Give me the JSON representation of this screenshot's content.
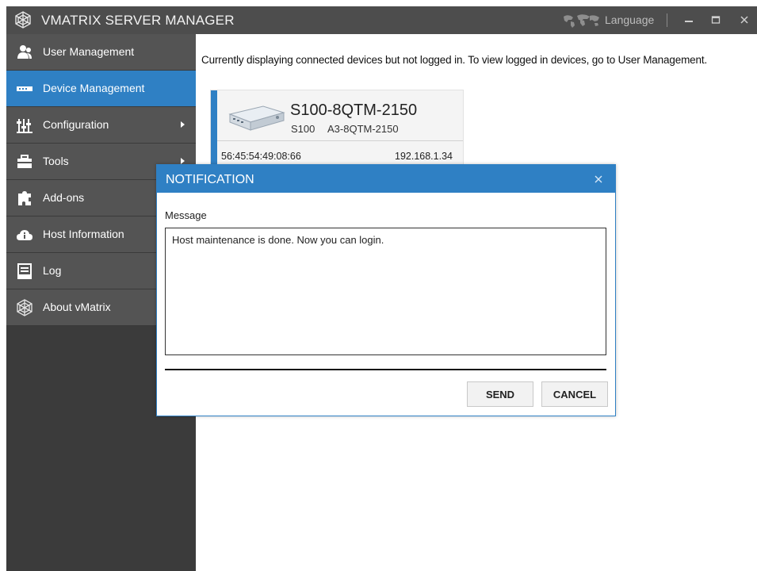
{
  "titlebar": {
    "title": "VMATRIX SERVER MANAGER",
    "language_label": "Language",
    "icons": [
      "app-logo-icon",
      "world-map-icon",
      "minimize-icon",
      "maximize-icon",
      "close-icon"
    ]
  },
  "sidebar": {
    "items": [
      {
        "label": "User Management",
        "icon": "user-icon",
        "active": false
      },
      {
        "label": "Device Management",
        "icon": "device-icon",
        "active": true
      },
      {
        "label": "Configuration",
        "icon": "sliders-icon",
        "submenu": true
      },
      {
        "label": "Tools",
        "icon": "toolbox-icon",
        "submenu": true
      },
      {
        "label": "Add-ons",
        "icon": "puzzle-icon"
      },
      {
        "label": "Host Information",
        "icon": "cloud-info-icon"
      },
      {
        "label": "Log",
        "icon": "log-icon"
      },
      {
        "label": "About vMatrix",
        "icon": "about-logo-icon"
      }
    ]
  },
  "main": {
    "info_text": "Currently displaying connected devices but not logged in. To view logged in devices, go to User Management.",
    "device": {
      "name": "S100-8QTM-2150",
      "model": "S100",
      "type": "A3-8QTM-2150",
      "mac": "56:45:54:49:08:66",
      "ip": "192.168.1.34"
    }
  },
  "dialog": {
    "title": "NOTIFICATION",
    "message_label": "Message",
    "message_text": "Host maintenance is done. Now you can login.",
    "send_label": "SEND",
    "cancel_label": "CANCEL"
  },
  "colors": {
    "accent": "#2f80c4",
    "titlebar": "#4d4d4d",
    "sidebar_item": "#545454",
    "sidebar_bg": "#3b3b3b"
  }
}
